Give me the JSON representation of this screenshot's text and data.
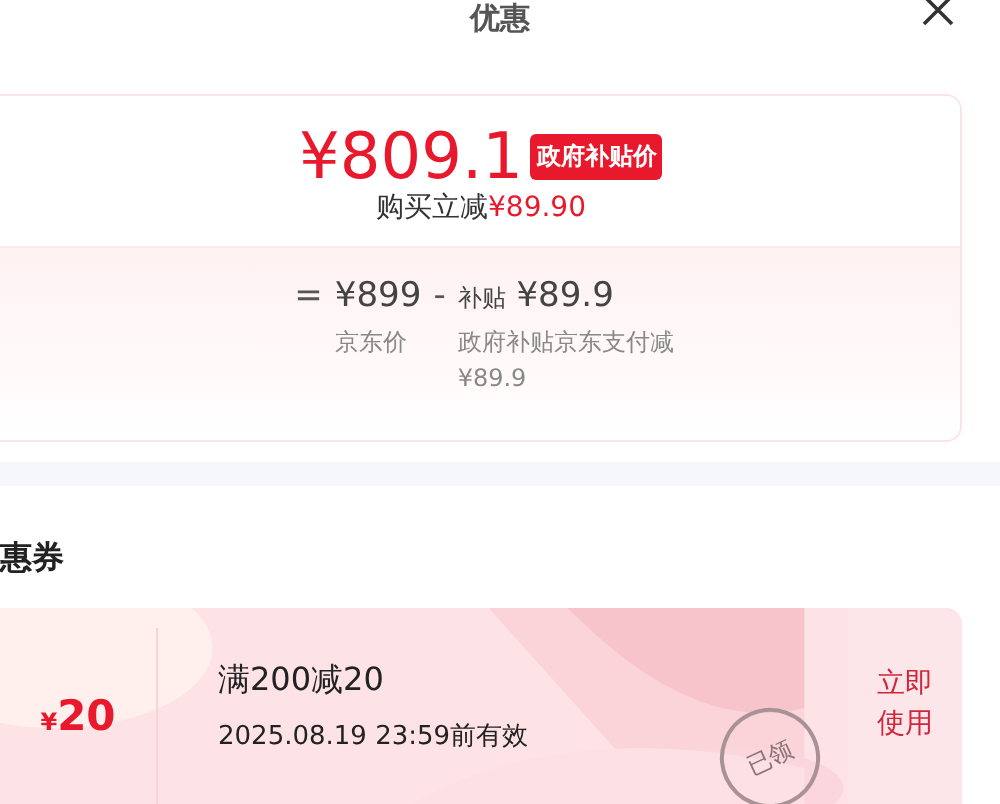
{
  "header": {
    "title": "优惠"
  },
  "price_card": {
    "price": "¥809.1",
    "badge": "政府补贴价",
    "saving_label": "购买立减",
    "saving_amount": "¥89.90",
    "breakdown": {
      "equals": "=",
      "base_price": "¥899",
      "minus": "-",
      "subsidy_label": "补贴",
      "subsidy_amount": "¥89.9",
      "base_caption": "京东价",
      "subsidy_caption": "政府补贴京东支付减¥89.9"
    }
  },
  "coupons_section": {
    "title": "惠券"
  },
  "coupons": [
    {
      "currency": "¥",
      "amount": "20",
      "rule": "满200减20",
      "expiry": "2025.08.19 23:59前有效",
      "claimed": true,
      "stamp": "已领",
      "action": "立即使用"
    }
  ]
}
